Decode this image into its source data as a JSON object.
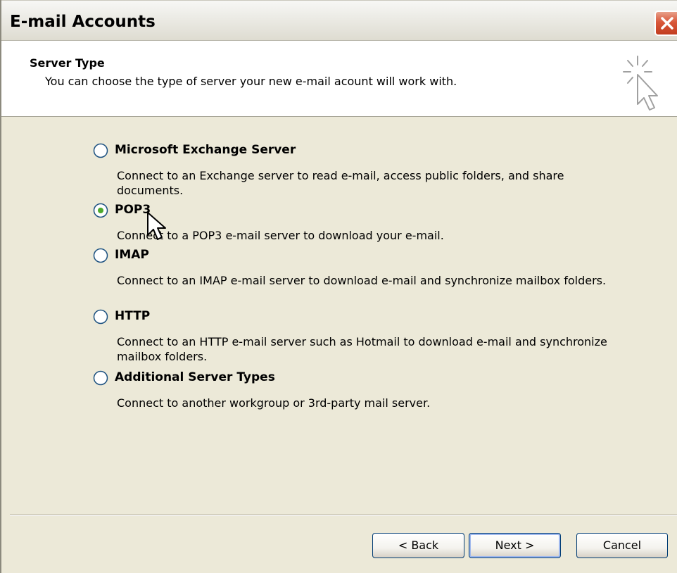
{
  "window": {
    "title": "E-mail Accounts"
  },
  "header": {
    "title": "Server Type",
    "description": "You can choose the type of server your new e-mail acount will work with."
  },
  "options": [
    {
      "label": "Microsoft Exchange Server",
      "description": "Connect to an Exchange server to read e-mail, access public folders, and share documents.",
      "selected": false
    },
    {
      "label": "POP3",
      "description": "Connect to a POP3 e-mail server to download your e-mail.",
      "selected": true
    },
    {
      "label": "IMAP",
      "description": "Connect to an IMAP e-mail server to download e-mail and synchronize mailbox folders.",
      "selected": false
    },
    {
      "label": "HTTP",
      "description": "Connect to an HTTP e-mail server such as Hotmail to download e-mail and synchronize mailbox folders.",
      "selected": false
    },
    {
      "label": "Additional Server Types",
      "description": "Connect to another workgroup or 3rd-party mail server.",
      "selected": false
    }
  ],
  "buttons": {
    "back": "< Back",
    "next": "Next >",
    "cancel": "Cancel"
  },
  "icons": {
    "close": "close-icon",
    "wizard": "wizard-cursor-icon",
    "radio_selected": "radio-selected-icon",
    "radio_unselected": "radio-unselected-icon"
  },
  "colors": {
    "dialog_background": "#ece9d8",
    "header_background": "#ffffff",
    "close_button": "#d9583a",
    "radio_selected_dot": "#4ca92b"
  }
}
